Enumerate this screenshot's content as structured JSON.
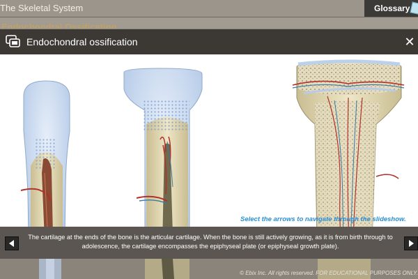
{
  "app": {
    "title": "The Skeletal System",
    "glossary_label": "Glossary",
    "section_title": "Endochondral Ossification"
  },
  "modal": {
    "title": "Endochondral ossification",
    "close_label": "✕",
    "instruction": "Select the arrows to navigate through the slideshow.",
    "caption": "The cartilage at the ends of the bone is the articular cartilage. When the bone is still actively growing, as it is from birth through to adolescence, the cartilage encompasses the epiphyseal plate (or epiphyseal growth plate)."
  },
  "footer": {
    "copyright": "© Ebix Inc. All rights reserved. FOR EDUCATIONAL PURPOSES ONLY."
  },
  "colors": {
    "header": "#3c3935",
    "caption_bar": "#5b5651",
    "instruction": "#2a8fd6",
    "cartilage": "#bcd0ea",
    "bone": "#e3d9b4"
  },
  "icons": {
    "modal_icon": "slideshow-icon",
    "prev": "arrow-left-icon",
    "next": "arrow-right-icon",
    "close": "close-icon"
  }
}
